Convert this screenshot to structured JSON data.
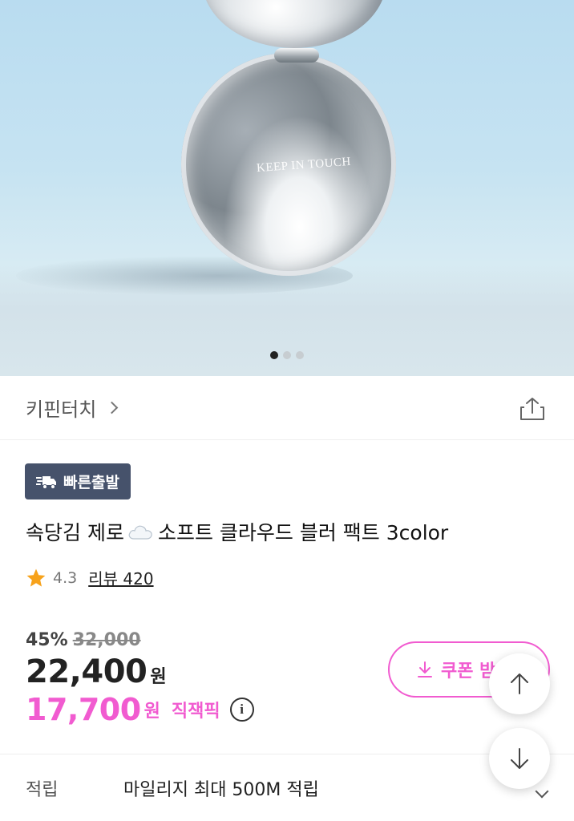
{
  "hero": {
    "product_logo_text": "KEEP IN TOUCH",
    "carousel": {
      "total": 3,
      "active_index": 0
    }
  },
  "brand": {
    "name": "키핀터치"
  },
  "badge": {
    "label": "빠른출발"
  },
  "product": {
    "title_part1": "속당김 제로",
    "title_part2": "소프트 클라우드 블러 팩트 3color"
  },
  "rating": {
    "score": "4.3",
    "review_label": "리뷰 420"
  },
  "price": {
    "discount_rate": "45%",
    "original": "32,000",
    "sale": "22,400",
    "sale_unit": "원",
    "pick_price": "17,700",
    "pick_unit": "원",
    "pick_label": "직잭픽",
    "info_symbol": "i"
  },
  "coupon": {
    "label": "쿠폰 받"
  },
  "mileage": {
    "label": "적립",
    "text": "마일리지 최대 500M 적립"
  },
  "colors": {
    "accent_pink": "#f15bd0",
    "badge_bg": "#46526b",
    "star": "#f7a21b"
  },
  "icons": [
    "share-icon",
    "cloud-icon",
    "star-icon",
    "info-icon",
    "download-icon",
    "arrow-up-icon",
    "arrow-down-icon",
    "chevron-right-icon",
    "chevron-down-icon",
    "delivery-truck-icon"
  ]
}
